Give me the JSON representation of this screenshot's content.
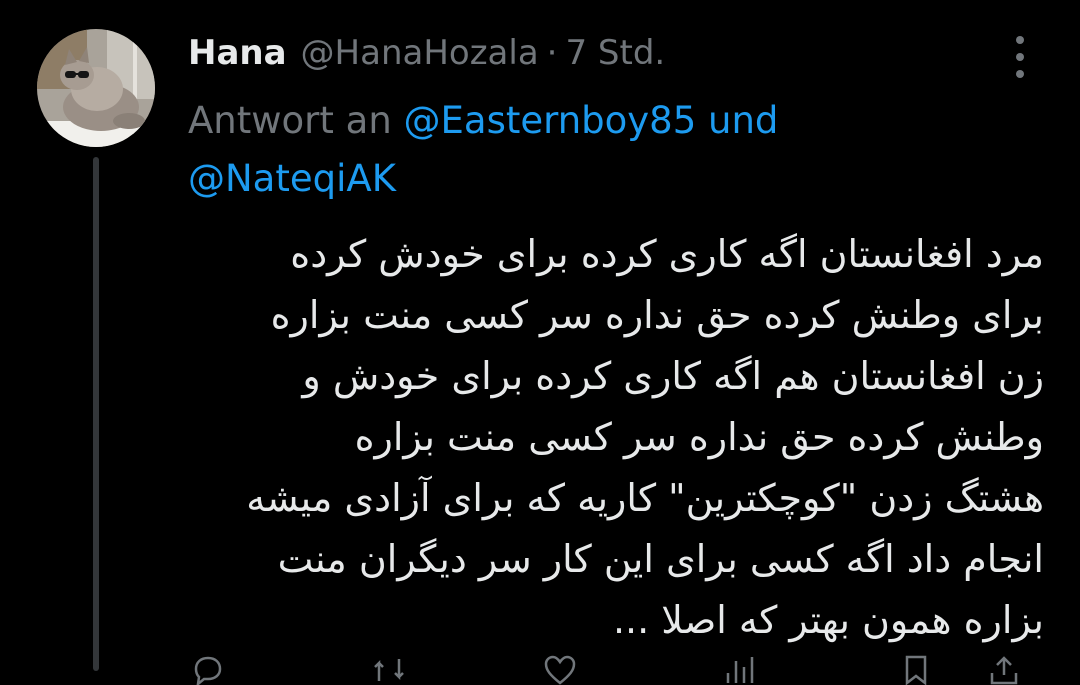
{
  "tweet": {
    "display_name": "Hana",
    "handle": "@HanaHozala",
    "separator": "·",
    "time": "7 Std.",
    "reply_prefix": "Antwort an",
    "reply_mention_1": "@Easternboy85",
    "reply_joiner": "und",
    "reply_mention_2": "@NateqiAK",
    "body_lines": [
      "مرد افغانستان اگه کاری کرده برای خودش کرده",
      "برای وطنش کرده حق نداره سر کسی منت بزاره",
      "زن افغانستان هم اگه کاری کرده برای خودش و",
      "وطنش کرده حق نداره سر کسی منت بزاره",
      "هشتگ زدن \"کوچکترین\" کاریه که برای آزادی میشه",
      "انجام داد اگه کسی برای این کار سر دیگران منت",
      "بزاره همون بهتر که اصلا ..."
    ]
  },
  "icons": {
    "avatar": "cat-with-sunglasses-avatar",
    "more": "more-options-icon",
    "reply": "reply-icon",
    "retweet": "retweet-icon",
    "like": "like-icon",
    "views": "views-icon",
    "share": "share-icon"
  },
  "colors": {
    "background": "#000000",
    "primary_text": "#e7e9ea",
    "secondary_text": "#71767b",
    "accent": "#1d9bf0",
    "thread_line": "#333639"
  }
}
